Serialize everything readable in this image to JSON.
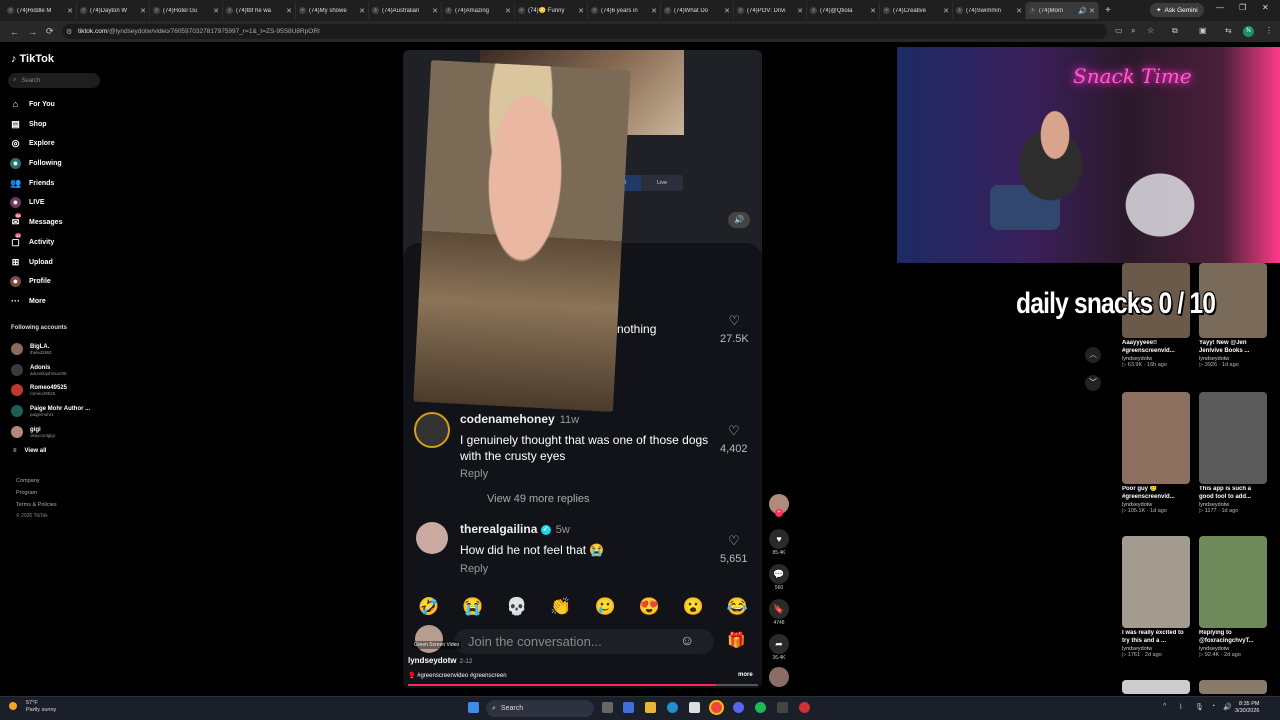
{
  "browser": {
    "tabs": [
      {
        "label": "(74)Riddle M"
      },
      {
        "label": "(74)Dayton W"
      },
      {
        "label": "(74)Hotel Gu"
      },
      {
        "label": "(74)tbf he wa"
      },
      {
        "label": "(74)My showe"
      },
      {
        "label": "(74)Australian"
      },
      {
        "label": "(74)Amazing"
      },
      {
        "label": "(74)😳 Funny"
      },
      {
        "label": "(74)6 years in"
      },
      {
        "label": "(74)What Do"
      },
      {
        "label": "(74)POV: Drivi"
      },
      {
        "label": "(74)@Qtiola"
      },
      {
        "label": "(74)Creative"
      },
      {
        "label": "(74)Swimmin"
      },
      {
        "label": "(74)Mom"
      }
    ],
    "ask_gemini": "Ask Gemini",
    "url_domain": "tiktok.com",
    "url_path": "/@lyndseydotw/video/7605970327817975997_r=1&_t=ZS-95S8U8RpORI",
    "profile_initial": "N"
  },
  "sidebar": {
    "logo": "TikTok",
    "search_placeholder": "Search",
    "items": [
      {
        "label": "For You"
      },
      {
        "label": "Shop"
      },
      {
        "label": "Explore"
      },
      {
        "label": "Following"
      },
      {
        "label": "Friends"
      },
      {
        "label": "LIVE"
      },
      {
        "label": "Messages",
        "badge": "68"
      },
      {
        "label": "Activity",
        "badge": "32"
      },
      {
        "label": "Upload"
      },
      {
        "label": "Profile"
      },
      {
        "label": "More"
      }
    ],
    "following_title": "Following accounts",
    "following": [
      {
        "name": "BigLA.",
        "handle": "thekid2891"
      },
      {
        "name": "Adonis",
        "handle": "adonisbjohnson06"
      },
      {
        "name": "Romeo49525",
        "handle": "romeo49525"
      },
      {
        "name": "Paige Mohr Author ...",
        "handle": "paigemohr1"
      },
      {
        "name": "gigi",
        "handle": "okaycoolgigi"
      }
    ],
    "view_all": "View all",
    "footer": [
      "Company",
      "Program",
      "Terms & Policies",
      "© 2026 TikTok"
    ]
  },
  "video": {
    "detected_label": "Detected",
    "live_label": "Live",
    "comments": [
      {
        "text_fragment": "nothing",
        "likes": "27.5K"
      },
      {
        "user": "codenamehoney",
        "time": "11w",
        "text": "I genuinely thought that was one of those dogs with the crusty eyes",
        "reply": "Reply",
        "likes": "4,402"
      },
      {
        "user": "therealgailina",
        "time": "5w",
        "text": "How did he not feel that 😭",
        "reply": "Reply",
        "likes": "5,651"
      }
    ],
    "view_more": "View 49 more replies",
    "emojis": [
      "🤣",
      "😭",
      "💀",
      "👏",
      "🥲",
      "😍",
      "😮",
      "😂"
    ],
    "join_placeholder": "Join the conversation...",
    "green_screen_label": "Green Screen Video",
    "author": "lyndseydotw",
    "date": "2-12",
    "tags": "🥊 #greenscreenvideo #greenscreen",
    "more": "more",
    "progress": 0.88
  },
  "actions": [
    {
      "icon": "heart-icon",
      "count": "85.4K"
    },
    {
      "icon": "comment-icon",
      "count": "560"
    },
    {
      "icon": "bookmark-icon",
      "count": "4748"
    },
    {
      "icon": "share-icon",
      "count": "36.4K"
    }
  ],
  "stream": {
    "neon_sign": "Snack Time",
    "overlay": "daily snacks  0 / 10"
  },
  "recommended": [
    {
      "title": "Aaayyyeee!! #greenscreenvid...",
      "user": "lyndseydotw",
      "views": "63.9K",
      "age": "16h ago"
    },
    {
      "title": "Yayy! New @Jen Jenlvive Books ...",
      "user": "lyndseydotw",
      "views": "3926",
      "age": "1d ago"
    },
    {
      "title": "Poor guy 🥲 #greenscreenvid...",
      "user": "lyndseydotw",
      "views": "105.1K",
      "age": "1d ago"
    },
    {
      "title": "This app is such a good tool to add...",
      "user": "lyndseydotw",
      "views": "1177",
      "age": "1d ago"
    },
    {
      "title": "I was really excited to try this and a ...",
      "user": "lyndseydotw",
      "views": "1761",
      "age": "2d ago"
    },
    {
      "title": "Replying to @foxracingchvyT...",
      "user": "lyndseydotw",
      "views": "92.4K",
      "age": "2d ago"
    }
  ],
  "taskbar": {
    "temp": "57°F",
    "weather": "Partly sunny",
    "search": "Search",
    "time": "8:35 PM",
    "date": "3/30/2026"
  }
}
